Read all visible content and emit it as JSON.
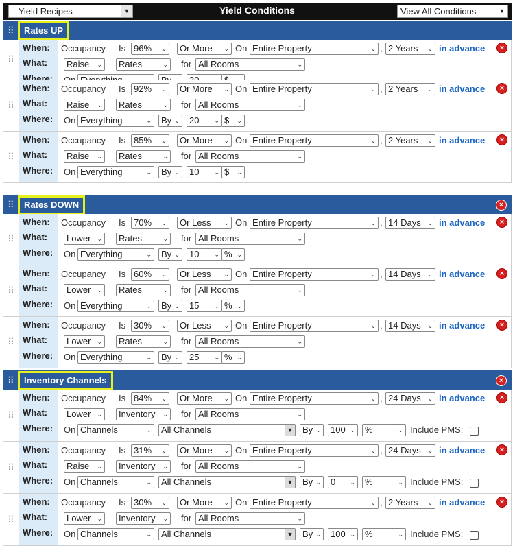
{
  "header": {
    "recipes_label": "- Yield Recipes -",
    "title": "Yield Conditions",
    "view_all_label": "View All Conditions"
  },
  "labels": {
    "when": "When:",
    "what": "What:",
    "where": "Where:",
    "occupancy": "Occupancy",
    "is": "Is",
    "on": "On",
    "for": "for",
    "by": "By",
    "in_advance": "in advance",
    "comma": ",",
    "include_pms": "Include PMS:"
  },
  "icons": {
    "drag": "drag-handle-icon",
    "delete": "delete-icon",
    "chevron": "chevron-down-icon"
  },
  "colors": {
    "group_bar": "#2a5b9c",
    "highlight": "#e8f01c",
    "label_col": "#dcebf8",
    "link": "#1a66c2",
    "delete": "#d62020"
  },
  "groups": [
    {
      "name": "Rates UP",
      "show_delete": false,
      "rules": [
        {
          "occ": "96%",
          "cmp": "Or More",
          "property": "Entire Property",
          "advance": "2 Years",
          "action": "Raise",
          "target": "Rates",
          "rooms": "All Rooms",
          "on": "Everything",
          "by": "By",
          "amount": "30",
          "unit": "$"
        },
        {
          "occ": "92%",
          "cmp": "Or More",
          "property": "Entire Property",
          "advance": "2 Years",
          "action": "Raise",
          "target": "Rates",
          "rooms": "All Rooms",
          "on": "Everything",
          "by": "By",
          "amount": "20",
          "unit": "$"
        },
        {
          "occ": "85%",
          "cmp": "Or More",
          "property": "Entire Property",
          "advance": "2 Years",
          "action": "Raise",
          "target": "Rates",
          "rooms": "All Rooms",
          "on": "Everything",
          "by": "By",
          "amount": "10",
          "unit": "$"
        }
      ]
    },
    {
      "name": "Rates DOWN",
      "show_delete": true,
      "rules": [
        {
          "occ": "70%",
          "cmp": "Or Less",
          "property": "Entire Property",
          "advance": "14 Days",
          "action": "Lower",
          "target": "Rates",
          "rooms": "All Rooms",
          "on": "Everything",
          "by": "By",
          "amount": "10",
          "unit": "%"
        },
        {
          "occ": "60%",
          "cmp": "Or Less",
          "property": "Entire Property",
          "advance": "14 Days",
          "action": "Lower",
          "target": "Rates",
          "rooms": "All Rooms",
          "on": "Everything",
          "by": "By",
          "amount": "15",
          "unit": "%"
        },
        {
          "occ": "30%",
          "cmp": "Or Less",
          "property": "Entire Property",
          "advance": "14 Days",
          "action": "Lower",
          "target": "Rates",
          "rooms": "All Rooms",
          "on": "Everything",
          "by": "By",
          "amount": "25",
          "unit": "%"
        }
      ]
    },
    {
      "name": "Inventory Channels",
      "show_delete": true,
      "rules": [
        {
          "occ": "84%",
          "cmp": "Or More",
          "property": "Entire Property",
          "advance": "24 Days",
          "action": "Lower",
          "target": "Inventory",
          "rooms": "All Rooms",
          "on": "Channels",
          "channels": "All Channels",
          "by": "By",
          "amount": "100",
          "unit": "%"
        },
        {
          "occ": "31%",
          "cmp": "Or More",
          "property": "Entire Property",
          "advance": "24 Days",
          "action": "Raise",
          "target": "Inventory",
          "rooms": "All Rooms",
          "on": "Channels",
          "channels": "All Channels",
          "by": "By",
          "amount": "0",
          "unit": "%"
        },
        {
          "occ": "30%",
          "cmp": "Or More",
          "property": "Entire Property",
          "advance": "2 Years",
          "action": "Lower",
          "target": "Inventory",
          "rooms": "All Rooms",
          "on": "Channels",
          "channels": "All Channels",
          "by": "By",
          "amount": "100",
          "unit": "%"
        }
      ]
    }
  ]
}
